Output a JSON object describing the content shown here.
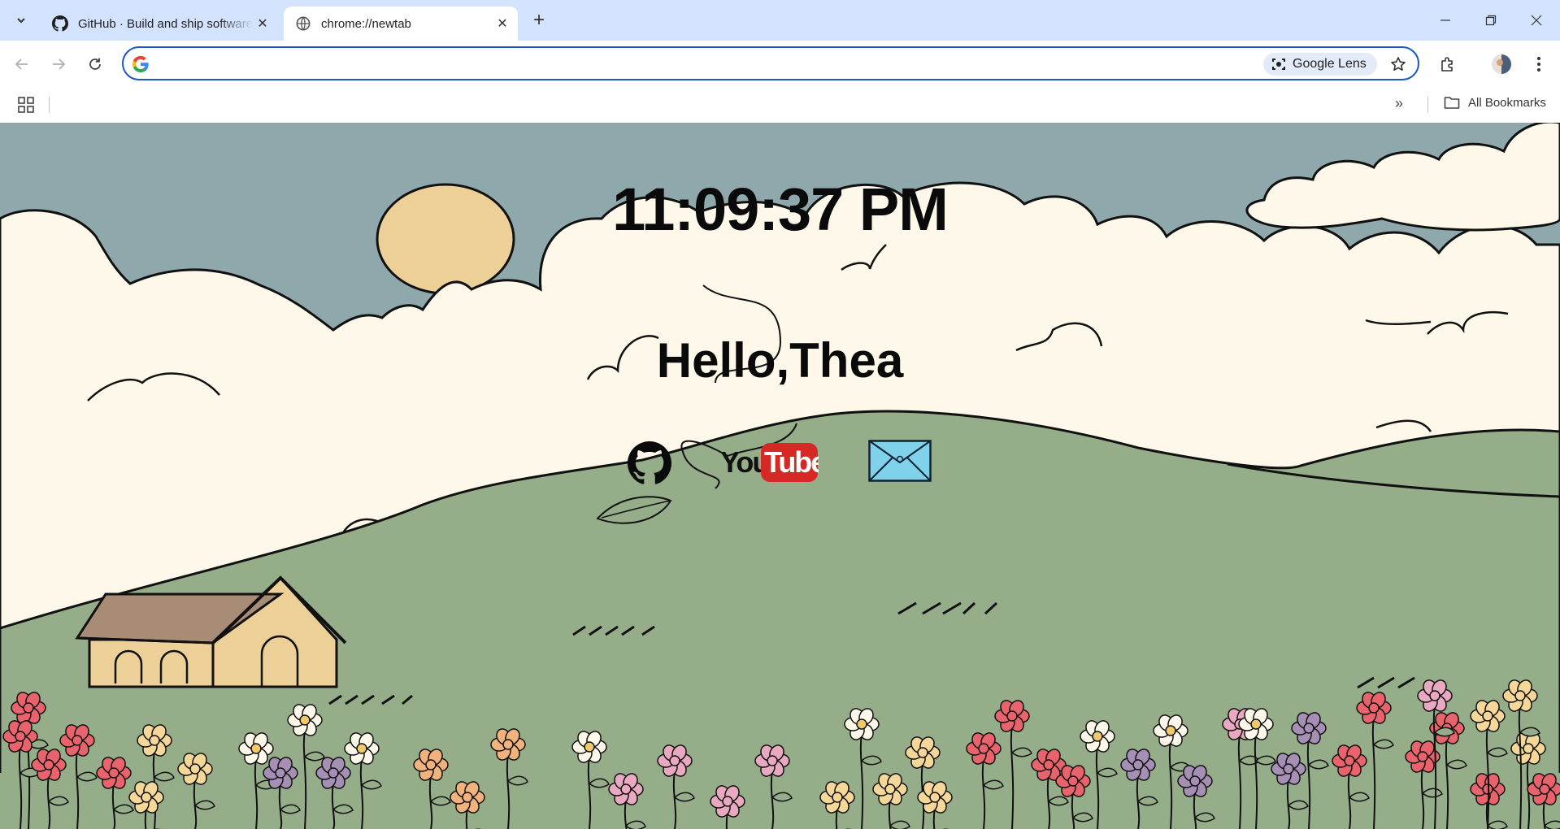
{
  "browser": {
    "tabs": [
      {
        "title": "GitHub · Build and ship software",
        "favicon": "github-icon",
        "active": false
      },
      {
        "title": "chrome://newtab",
        "favicon": "globe-icon",
        "active": true
      }
    ],
    "omnibox": {
      "value": "",
      "placeholder": ""
    },
    "lens_label": "Google Lens",
    "bookmarks": {
      "all_bookmarks_label": "All Bookmarks"
    }
  },
  "newtab": {
    "clock": "11:09:37 PM",
    "greeting": "Hello,Thea",
    "shortcuts": [
      {
        "name": "GitHub",
        "icon": "github-icon"
      },
      {
        "name": "YouTube",
        "icon": "youtube-logo",
        "logo_text_you": "You",
        "logo_text_tube": "Tube"
      },
      {
        "name": "Mail",
        "icon": "envelope-icon"
      }
    ]
  },
  "colors": {
    "sky": "#8fa8ac",
    "cloud": "#fdf8ea",
    "sun": "#ecd098",
    "hill": "#95ad88",
    "house_roof": "#a98c76",
    "house_wall": "#ecd098",
    "youtube_red": "#d62825",
    "envelope": "#7fd2ea",
    "tabstrip": "#d3e3fd",
    "omnibox_border": "#1a56c4"
  }
}
